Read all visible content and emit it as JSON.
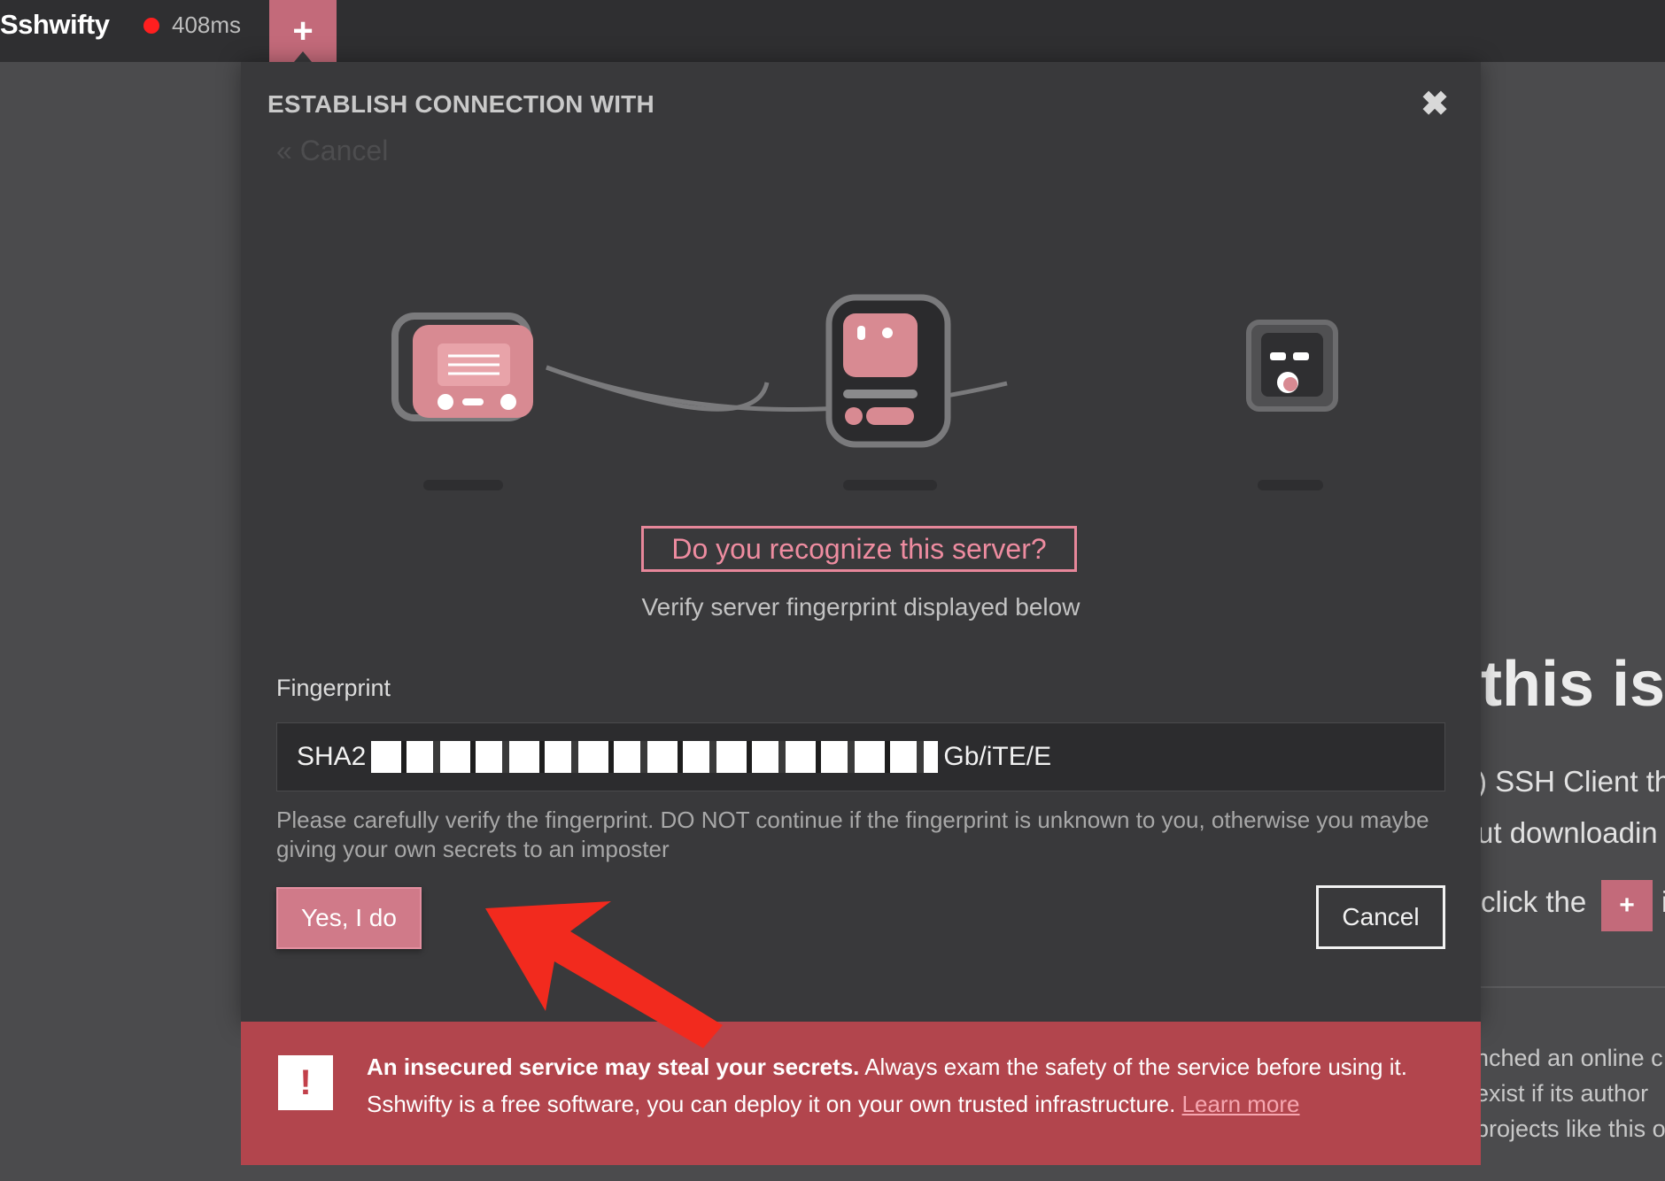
{
  "topbar": {
    "brand": "Sshwifty",
    "latency": "408ms",
    "add_tab_label": "+"
  },
  "modal": {
    "title": "ESTABLISH CONNECTION WITH",
    "close_label": "✖",
    "back_label": "« Cancel",
    "question": "Do you recognize this server?",
    "subtitle": "Verify server fingerprint displayed below",
    "fingerprint_label": "Fingerprint",
    "fingerprint_prefix": "SHA2",
    "fingerprint_suffix": "Gb/iTE/E",
    "warning": "Please carefully verify the fingerprint. DO NOT continue if the fingerprint is unknown to you, otherwise you maybe giving your own secrets to an imposter",
    "confirm_button": "Yes, I do",
    "cancel_button": "Cancel"
  },
  "banner": {
    "icon": "!",
    "bold": "An insecured service may steal your secrets.",
    "text": " Always exam the safety of the service before using it. Sshwifty is a free software, you can deploy it on your own trusted infrastructure. ",
    "link": "Learn more"
  },
  "background": {
    "heading": "this is",
    "line1": ") SSH Client th",
    "line2": "ut downloadin",
    "line3": "click the",
    "line3_button": "+",
    "line3_tail": "i",
    "small1": "nched an online c",
    "small2": "exist if its author",
    "small3": "projects like this o"
  },
  "colors": {
    "accent": "#c36a7a",
    "question_border": "#e7879a",
    "banner": "#b2454d",
    "status_dot": "#ff1f1f",
    "annotation_arrow": "#f22a1e"
  },
  "icons": {
    "client": "client-device-icon",
    "server": "server-device-icon",
    "target": "target-device-icon"
  }
}
